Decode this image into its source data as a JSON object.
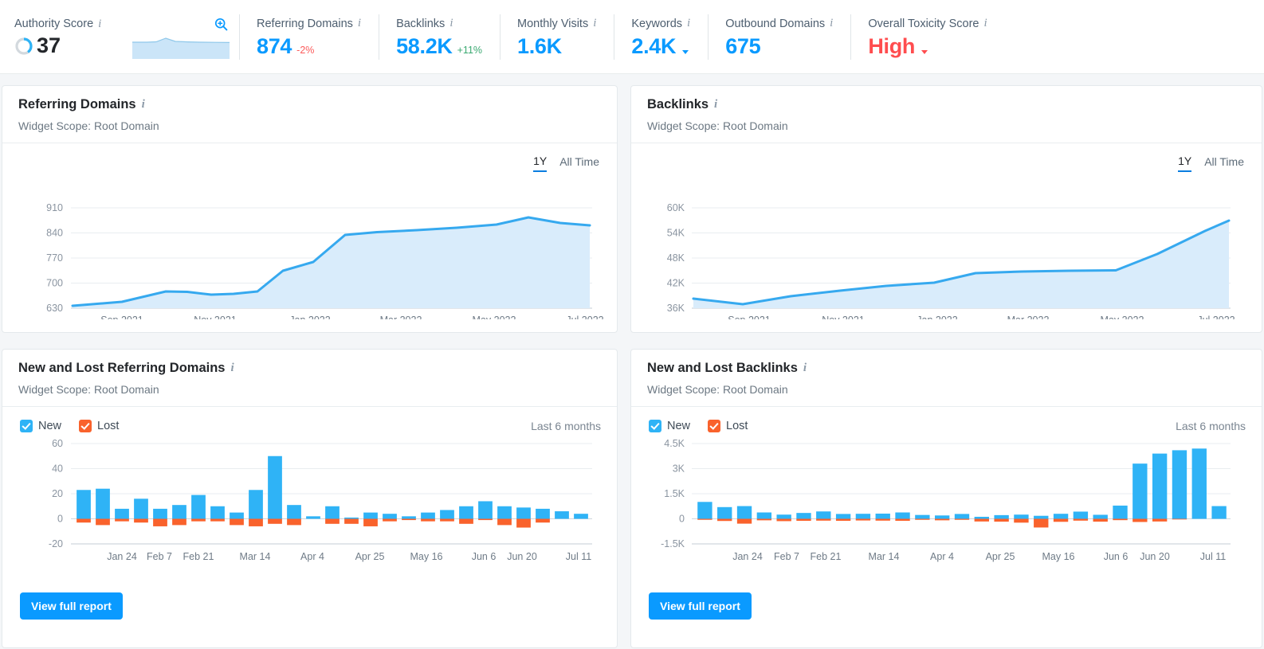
{
  "topbar": {
    "metrics": [
      {
        "label": "Authority Score",
        "value": "37",
        "type": "authority"
      },
      {
        "label": "Referring Domains",
        "value": "874",
        "delta": "-2%",
        "delta_dir": "neg"
      },
      {
        "label": "Backlinks",
        "value": "58.2K",
        "delta": "+11%",
        "delta_dir": "pos"
      },
      {
        "label": "Monthly Visits",
        "value": "1.6K"
      },
      {
        "label": "Keywords",
        "value": "2.4K",
        "dropdown": true
      },
      {
        "label": "Outbound Domains",
        "value": "675"
      },
      {
        "label": "Overall Toxicity Score",
        "value": "High",
        "dropdown": true,
        "color": "#ff4d4f"
      }
    ],
    "authority": {
      "label": "Authority Score",
      "score": "37",
      "magnifier_icon": "zoom-in-icon",
      "info_icon": "info-icon"
    },
    "referring_domains": {
      "label": "Referring Domains",
      "value": "874",
      "delta": "-2%"
    },
    "backlinks": {
      "label": "Backlinks",
      "value": "58.2K",
      "delta": "+11%"
    },
    "monthly_visits": {
      "label": "Monthly Visits",
      "value": "1.6K"
    },
    "keywords": {
      "label": "Keywords",
      "value": "2.4K"
    },
    "outbound_domains": {
      "label": "Outbound Domains",
      "value": "675"
    },
    "toxicity": {
      "label": "Overall Toxicity Score",
      "value": "High"
    }
  },
  "colors": {
    "accent_blue": "#0a9aff",
    "bar_blue": "#2fb3f6",
    "bar_orange": "#f9622c",
    "line_blue": "#33aaf0",
    "area_fill": "#d7ebfb",
    "negative_red": "#fb5b5b",
    "positive_green": "#3aa971",
    "toxicity_high": "#ff4d4f"
  },
  "cards": {
    "referring_domains": {
      "title": "Referring Domains",
      "scope": "Widget Scope: Root Domain",
      "period_1y": "1Y",
      "period_all": "All Time",
      "period_active": "1Y"
    },
    "backlinks": {
      "title": "Backlinks",
      "scope": "Widget Scope: Root Domain",
      "period_1y": "1Y",
      "period_all": "All Time",
      "period_active": "1Y"
    },
    "new_lost_referring_domains": {
      "title": "New and Lost Referring Domains",
      "scope": "Widget Scope: Root Domain",
      "legend_new": "New",
      "legend_lost": "Lost",
      "range": "Last 6 months",
      "button": "View full report"
    },
    "new_lost_backlinks": {
      "title": "New and Lost Backlinks",
      "scope": "Widget Scope: Root Domain",
      "legend_new": "New",
      "legend_lost": "Lost",
      "range": "Last 6 months",
      "button": "View full report"
    }
  },
  "chart_data": [
    {
      "id": "referring-domains-trend",
      "type": "area",
      "title": "Referring Domains",
      "xlabel": "",
      "ylabel": "",
      "ylim": [
        630,
        945
      ],
      "yticks": [
        630,
        700,
        770,
        840,
        910
      ],
      "ytick_labels": [
        "630",
        "700",
        "770",
        "840",
        "910"
      ],
      "xtick_labels": [
        "Sep 2021",
        "Nov 2021",
        "Jan 2022",
        "Mar 2022",
        "May 2022",
        "Jul 2022"
      ],
      "x": [
        "Aug 2021",
        "Sep 2021",
        "Oct 2021",
        "Nov 2021",
        "Dec 2021",
        "Jan 2022",
        "Feb 2022",
        "Mar 2022",
        "Apr 2022",
        "May 2022",
        "Jun 2022",
        "Jul 2022"
      ],
      "values": [
        636,
        645,
        672,
        665,
        663,
        672,
        748,
        778,
        852,
        862,
        868,
        893,
        874
      ],
      "series": [
        {
          "name": "Referring Domains",
          "points": [
            {
              "x": "Aug 2021",
              "y": 636
            },
            {
              "x": "Sep 2021",
              "y": 648
            },
            {
              "x": "Oct 2021",
              "y": 672
            },
            {
              "x": "Oct 15 2021",
              "y": 668
            },
            {
              "x": "Nov 2021",
              "y": 664
            },
            {
              "x": "Dec 2021",
              "y": 673
            },
            {
              "x": "Jan 2022",
              "y": 748
            },
            {
              "x": "Feb 2022",
              "y": 778
            },
            {
              "x": "Mar 2022",
              "y": 851
            },
            {
              "x": "Apr 2022",
              "y": 858
            },
            {
              "x": "May 2022",
              "y": 864
            },
            {
              "x": "Jun 2022",
              "y": 893
            },
            {
              "x": "Jul 2022",
              "y": 876
            }
          ]
        }
      ],
      "grid": true,
      "legend": "none"
    },
    {
      "id": "backlinks-trend",
      "type": "area",
      "title": "Backlinks",
      "xlabel": "",
      "ylabel": "",
      "ylim": [
        36000,
        63000
      ],
      "yticks": [
        36000,
        42000,
        48000,
        54000,
        60000
      ],
      "ytick_labels": [
        "36K",
        "42K",
        "48K",
        "54K",
        "60K"
      ],
      "xtick_labels": [
        "Sep 2021",
        "Nov 2021",
        "Jan 2022",
        "Mar 2022",
        "May 2022",
        "Jul 2022"
      ],
      "series": [
        {
          "name": "Backlinks",
          "points": [
            {
              "x": "Aug 2021",
              "y": 38400
            },
            {
              "x": "Sep 2021",
              "y": 37300
            },
            {
              "x": "Oct 2021",
              "y": 38900
            },
            {
              "x": "Nov 2021",
              "y": 39900
            },
            {
              "x": "Dec 2021",
              "y": 40700
            },
            {
              "x": "Jan 2022",
              "y": 41400
            },
            {
              "x": "Feb 2022",
              "y": 43600
            },
            {
              "x": "Mar 2022",
              "y": 44000
            },
            {
              "x": "Apr 2022",
              "y": 44200
            },
            {
              "x": "May 2022",
              "y": 44300
            },
            {
              "x": "Jun 2022",
              "y": 52700
            },
            {
              "x": "Jul 2022",
              "y": 58300
            }
          ]
        }
      ],
      "grid": true,
      "legend": "none"
    },
    {
      "id": "new-lost-referring-domains",
      "type": "bar",
      "title": "New and Lost Referring Domains",
      "stacked_diverging": true,
      "ylim": [
        -20,
        62
      ],
      "yticks": [
        -20,
        0,
        20,
        40,
        60
      ],
      "ytick_labels": [
        "-20",
        "0",
        "20",
        "40",
        "60"
      ],
      "xtick_labels": [
        "Jan 24",
        "Feb 7",
        "Feb 21",
        "Mar 14",
        "Apr 4",
        "Apr 25",
        "May 16",
        "Jun 6",
        "Jun 20",
        "Jul 11"
      ],
      "xtick_index": [
        1,
        3,
        5,
        8,
        11,
        14,
        17,
        20,
        22,
        25
      ],
      "categories": [
        "Jan 17",
        "Jan 24",
        "Jan 31",
        "Feb 7",
        "Feb 14",
        "Feb 21",
        "Feb 28",
        "Mar 7",
        "Mar 14",
        "Mar 21",
        "Mar 28",
        "Apr 4",
        "Apr 11",
        "Apr 18",
        "Apr 25",
        "May 2",
        "May 9",
        "May 16",
        "May 23",
        "May 30",
        "Jun 6",
        "Jun 13",
        "Jun 20",
        "Jun 27",
        "Jul 4",
        "Jul 11"
      ],
      "series": [
        {
          "name": "New",
          "color": "#2fb3f6",
          "values": [
            23,
            24,
            8,
            16,
            8,
            11,
            19,
            10,
            5,
            23,
            50,
            11,
            2,
            10,
            1,
            5,
            4,
            2,
            5,
            7,
            10,
            14,
            10,
            9,
            8,
            6,
            4
          ]
        },
        {
          "name": "Lost",
          "color": "#f9622c",
          "values": [
            -3,
            -5,
            -2,
            -3,
            -6,
            -5,
            -2,
            -2,
            -5,
            -6,
            -4,
            -5,
            0,
            -4,
            -4,
            -6,
            -2,
            -1,
            -2,
            -2,
            -4,
            -1,
            -5,
            -7,
            -3,
            0,
            0
          ]
        }
      ],
      "grid": true,
      "legend": "top-left"
    },
    {
      "id": "new-lost-backlinks",
      "type": "bar",
      "title": "New and Lost Backlinks",
      "stacked_diverging": true,
      "ylim": [
        -1500,
        4800
      ],
      "yticks": [
        -1500,
        0,
        1500,
        3000,
        4500
      ],
      "ytick_labels": [
        "-1.5K",
        "0",
        "1.5K",
        "3K",
        "4.5K"
      ],
      "xtick_labels": [
        "Jan 24",
        "Feb 7",
        "Feb 21",
        "Mar 14",
        "Apr 4",
        "Apr 25",
        "May 16",
        "Jun 6",
        "Jun 20",
        "Jul 11"
      ],
      "xtick_index": [
        1,
        3,
        5,
        8,
        11,
        14,
        17,
        20,
        22,
        25
      ],
      "categories": [
        "Jan 17",
        "Jan 24",
        "Jan 31",
        "Feb 7",
        "Feb 14",
        "Feb 21",
        "Feb 28",
        "Mar 7",
        "Mar 14",
        "Mar 21",
        "Mar 28",
        "Apr 4",
        "Apr 11",
        "Apr 18",
        "Apr 25",
        "May 2",
        "May 9",
        "May 16",
        "May 23",
        "May 30",
        "Jun 6",
        "Jun 13",
        "Jun 20",
        "Jun 27",
        "Jul 4",
        "Jul 11"
      ],
      "series": [
        {
          "name": "New",
          "color": "#2fb3f6",
          "values": [
            1010,
            700,
            760,
            380,
            250,
            350,
            440,
            290,
            300,
            310,
            380,
            230,
            200,
            290,
            120,
            220,
            250,
            180,
            300,
            430,
            240,
            790,
            3300,
            3900,
            4100,
            4200,
            760
          ]
        },
        {
          "name": "Lost",
          "color": "#f9622c",
          "values": [
            -60,
            -130,
            -290,
            -90,
            -140,
            -120,
            -110,
            -120,
            -100,
            -110,
            -120,
            -60,
            -90,
            -60,
            -160,
            -170,
            -230,
            -520,
            -180,
            -110,
            -170,
            -80,
            -190,
            -160,
            -40,
            0,
            0
          ]
        }
      ],
      "grid": true,
      "legend": "top-left"
    }
  ]
}
